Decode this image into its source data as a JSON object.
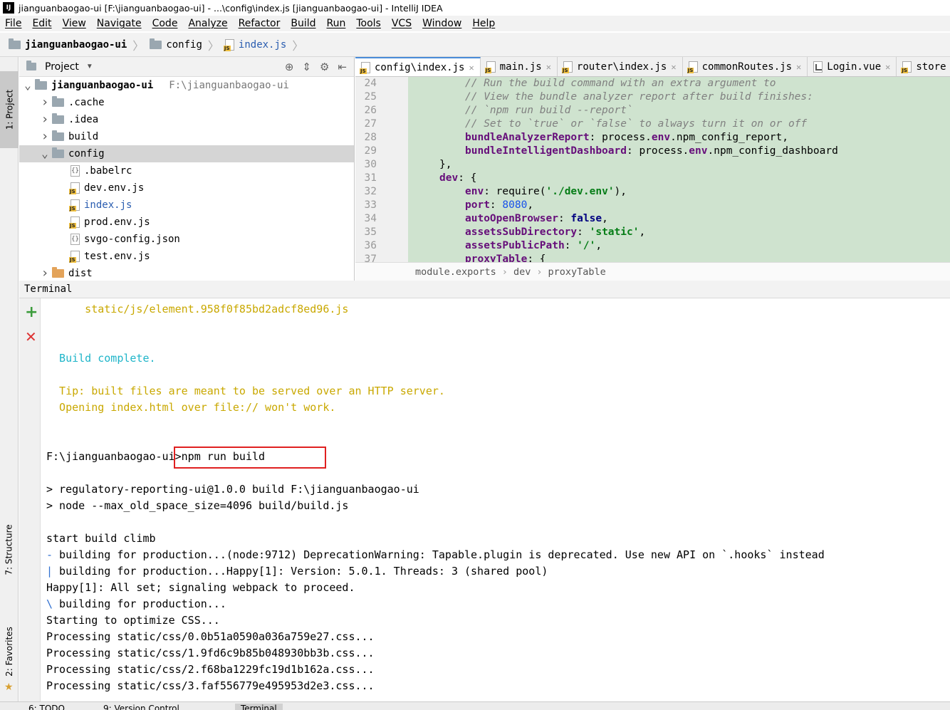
{
  "window": {
    "title": "jianguanbaogao-ui [F:\\jianguanbaogao-ui] - ...\\config\\index.js [jianguanbaogao-ui] - IntelliJ IDEA",
    "app_icon_text": "IJ"
  },
  "menu": [
    "File",
    "Edit",
    "View",
    "Navigate",
    "Code",
    "Analyze",
    "Refactor",
    "Build",
    "Run",
    "Tools",
    "VCS",
    "Window",
    "Help"
  ],
  "navbar": {
    "crumbs": [
      "jianguanbaogao-ui",
      "config",
      "index.js"
    ]
  },
  "left_strip": {
    "project_tab": "1: Project",
    "structure_tab": "7: Structure",
    "favorites_tab": "2: Favorites"
  },
  "project": {
    "title": "Project",
    "tree": [
      {
        "label": "jianguanbaogao-ui",
        "path": "F:\\jianguanbaogao-ui",
        "type": "root-folder",
        "arrow": "expanded",
        "depth": 0
      },
      {
        "label": ".cache",
        "type": "folder",
        "arrow": "collapsed",
        "depth": 1
      },
      {
        "label": ".idea",
        "type": "folder",
        "arrow": "collapsed",
        "depth": 1
      },
      {
        "label": "build",
        "type": "folder",
        "arrow": "collapsed",
        "depth": 1
      },
      {
        "label": "config",
        "type": "folder",
        "arrow": "expanded",
        "depth": 1,
        "selected": true
      },
      {
        "label": ".babelrc",
        "type": "json",
        "depth": 2
      },
      {
        "label": "dev.env.js",
        "type": "js",
        "depth": 2
      },
      {
        "label": "index.js",
        "type": "js",
        "depth": 2,
        "active": true
      },
      {
        "label": "prod.env.js",
        "type": "js",
        "depth": 2
      },
      {
        "label": "svgo-config.json",
        "type": "json",
        "depth": 2
      },
      {
        "label": "test.env.js",
        "type": "js",
        "depth": 2
      },
      {
        "label": "dist",
        "type": "folder-orange",
        "arrow": "collapsed",
        "depth": 1
      }
    ]
  },
  "editor": {
    "tabs": [
      {
        "label": "config\\index.js",
        "icon": "js",
        "active": true
      },
      {
        "label": "main.js",
        "icon": "js"
      },
      {
        "label": "router\\index.js",
        "icon": "js"
      },
      {
        "label": "commonRoutes.js",
        "icon": "js"
      },
      {
        "label": "Login.vue",
        "icon": "vue"
      },
      {
        "label": "store",
        "icon": "js"
      }
    ],
    "lines": [
      {
        "n": "24",
        "indent": "    ",
        "parts": [
          [
            "comment",
            "// Run the build command with an extra argument to"
          ]
        ]
      },
      {
        "n": "25",
        "indent": "    ",
        "parts": [
          [
            "comment",
            "// View the bundle analyzer report after build finishes:"
          ]
        ]
      },
      {
        "n": "26",
        "indent": "    ",
        "parts": [
          [
            "comment",
            "// `npm run build --report`"
          ]
        ]
      },
      {
        "n": "27",
        "indent": "    ",
        "parts": [
          [
            "comment",
            "// Set to `true` or `false` to always turn it on or off"
          ]
        ]
      },
      {
        "n": "28",
        "indent": "    ",
        "parts": [
          [
            "key",
            "bundleAnalyzerReport"
          ],
          [
            "plain",
            ": process."
          ],
          [
            "key",
            "env"
          ],
          [
            "plain",
            ".npm_config_report,"
          ]
        ]
      },
      {
        "n": "29",
        "indent": "    ",
        "parts": [
          [
            "key",
            "bundleIntelligentDashboard"
          ],
          [
            "plain",
            ": process."
          ],
          [
            "key",
            "env"
          ],
          [
            "plain",
            ".npm_config_dashboard"
          ]
        ]
      },
      {
        "n": "30",
        "indent": "",
        "parts": [
          [
            "plain",
            "},"
          ]
        ]
      },
      {
        "n": "31",
        "indent": "",
        "parts": [
          [
            "key",
            "dev"
          ],
          [
            "plain",
            ": {"
          ]
        ]
      },
      {
        "n": "32",
        "indent": "    ",
        "parts": [
          [
            "key",
            "env"
          ],
          [
            "plain",
            ": require("
          ],
          [
            "str",
            "'./dev.env'"
          ],
          [
            "plain",
            "),"
          ]
        ]
      },
      {
        "n": "33",
        "indent": "    ",
        "parts": [
          [
            "key",
            "port"
          ],
          [
            "plain",
            ": "
          ],
          [
            "num",
            "8080"
          ],
          [
            "plain",
            ","
          ]
        ]
      },
      {
        "n": "34",
        "indent": "    ",
        "parts": [
          [
            "key",
            "autoOpenBrowser"
          ],
          [
            "plain",
            ": "
          ],
          [
            "kw",
            "false"
          ],
          [
            "plain",
            ","
          ]
        ]
      },
      {
        "n": "35",
        "indent": "    ",
        "parts": [
          [
            "key",
            "assetsSubDirectory"
          ],
          [
            "plain",
            ": "
          ],
          [
            "str",
            "'static'"
          ],
          [
            "plain",
            ","
          ]
        ]
      },
      {
        "n": "36",
        "indent": "    ",
        "parts": [
          [
            "key",
            "assetsPublicPath"
          ],
          [
            "plain",
            ": "
          ],
          [
            "str",
            "'/'"
          ],
          [
            "plain",
            ","
          ]
        ]
      },
      {
        "n": "37",
        "indent": "    ",
        "parts": [
          [
            "key",
            "proxyTable"
          ],
          [
            "plain",
            ": {"
          ]
        ]
      }
    ],
    "breadcrumb": [
      "module.exports",
      "dev",
      "proxyTable"
    ]
  },
  "terminal": {
    "title": "Terminal",
    "lines": [
      {
        "color": "yellow",
        "text": "      static/js/element.958f0f85bd2adcf8ed96.js"
      },
      {
        "color": "plain",
        "text": ""
      },
      {
        "color": "plain",
        "text": ""
      },
      {
        "color": "cyan",
        "text": "  Build complete."
      },
      {
        "color": "plain",
        "text": ""
      },
      {
        "color": "yellow",
        "text": "  Tip: built files are meant to be served over an HTTP server."
      },
      {
        "color": "yellow",
        "text": "  Opening index.html over file:// won't work."
      },
      {
        "color": "plain",
        "text": ""
      },
      {
        "color": "plain",
        "text": ""
      },
      {
        "color": "plain",
        "text": "F:\\jianguanbaogao-ui>npm run build"
      },
      {
        "color": "plain",
        "text": ""
      },
      {
        "color": "plain",
        "text": "> regulatory-reporting-ui@1.0.0 build F:\\jianguanbaogao-ui"
      },
      {
        "color": "plain",
        "text": "> node --max_old_space_size=4096 build/build.js"
      },
      {
        "color": "plain",
        "text": ""
      },
      {
        "color": "plain",
        "text": "start build climb"
      },
      {
        "color": "plain",
        "spinner": "-",
        "text": " building for production...(node:9712) DeprecationWarning: Tapable.plugin is deprecated. Use new API on `.hooks` instead"
      },
      {
        "color": "plain",
        "spinner": "|",
        "text": " building for production...Happy[1]: Version: 5.0.1. Threads: 3 (shared pool)"
      },
      {
        "color": "plain",
        "text": "Happy[1]: All set; signaling webpack to proceed."
      },
      {
        "color": "plain",
        "spinner": "\\",
        "text": " building for production..."
      },
      {
        "color": "plain",
        "text": "Starting to optimize CSS..."
      },
      {
        "color": "plain",
        "text": "Processing static/css/0.0b51a0590a036a759e27.css..."
      },
      {
        "color": "plain",
        "text": "Processing static/css/1.9fd6c9b85b048930bb3b.css..."
      },
      {
        "color": "plain",
        "text": "Processing static/css/2.f68ba1229fc19d1b162a.css..."
      },
      {
        "color": "plain",
        "text": "Processing static/css/3.faf556779e495953d2e3.css..."
      }
    ]
  },
  "bottom_tabs": [
    "6: TODO",
    "9: Version Control",
    "Terminal"
  ],
  "colors": {
    "editor_bg": "#cfe3cf",
    "comment": "#808080",
    "key": "#660e7a",
    "string": "#067d17",
    "number": "#1750eb",
    "terminal_yellow": "#c9a800",
    "terminal_cyan": "#1fb5c9",
    "highlight_box": "#e02020"
  }
}
